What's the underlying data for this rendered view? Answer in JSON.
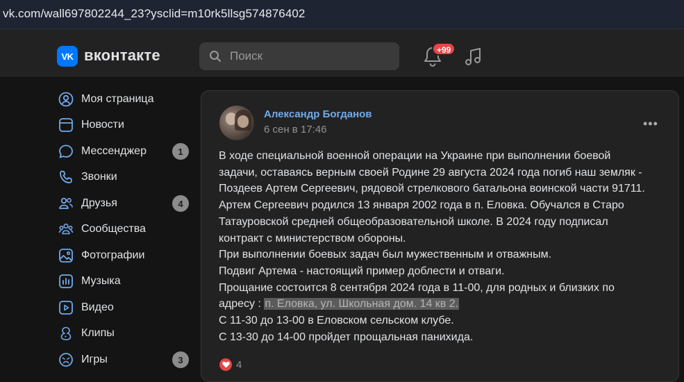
{
  "browser": {
    "url": "vk.com/wall697802244_23?ysclid=m10rk5llsg574876402"
  },
  "header": {
    "logo_mark": "VK",
    "logo_text": "вконтакте",
    "search_placeholder": "Поиск",
    "notifications_badge": "+99"
  },
  "sidebar": {
    "items": [
      {
        "label": "Моя страница",
        "icon": "user-circle-icon"
      },
      {
        "label": "Новости",
        "icon": "news-icon"
      },
      {
        "label": "Мессенджер",
        "icon": "message-icon",
        "count": "1"
      },
      {
        "label": "Звонки",
        "icon": "phone-icon"
      },
      {
        "label": "Друзья",
        "icon": "friends-icon",
        "count": "4"
      },
      {
        "label": "Сообщества",
        "icon": "communities-icon"
      },
      {
        "label": "Фотографии",
        "icon": "photo-icon"
      },
      {
        "label": "Музыка",
        "icon": "music-icon"
      },
      {
        "label": "Видео",
        "icon": "video-icon"
      },
      {
        "label": "Клипы",
        "icon": "clips-icon"
      },
      {
        "label": "Игры",
        "icon": "games-icon",
        "count": "3"
      }
    ]
  },
  "post": {
    "author": "Александр Богданов",
    "date": "6 сен в 17:46",
    "lines": [
      "В ходе специальной военной операции на Украине при выполнении боевой",
      "задачи, оставаясь верным своей Родине 29 августа 2024 года погиб наш земляк -",
      "Поздеев Артем Сергеевич, рядовой стрелкового батальона воинской части 91711.",
      "Артем Сергеевич родился 13 января 2002 года в п. Еловка. Обучался в Старо",
      "Татауровской средней общеобразовательной школе. В 2024 году подписал",
      "контракт с министерством обороны.",
      "При выполнении боевых задач был мужественным и отважным.",
      "Подвиг Артема - настоящий пример доблести и отваги.",
      "Прощание состоится 8 сентября 2024 года в 11-00, для родных и близких по"
    ],
    "address_prefix": "адресу : ",
    "address_highlight": "п. Еловка, ул. Школьная дом. 14 кв 2.",
    "lines_after": [
      "С 11-30 до 13-00 в Еловском сельском клубе.",
      "С 13-30 до 14-00 пройдет прощальная панихида."
    ],
    "likes_count": "4"
  },
  "colors": {
    "accent": "#0077ff",
    "link": "#71aaeb",
    "badge": "#e64646"
  }
}
